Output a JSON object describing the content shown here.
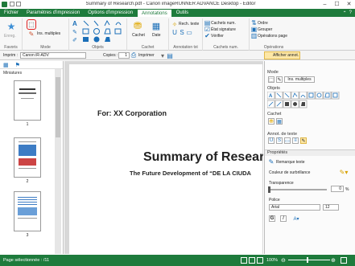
{
  "window": {
    "title": "Summary of Research.pdf - Canon imageRUNNER ADVANCE Desktop - Editor",
    "minimize": "–",
    "maximize": "☐",
    "close": "✕"
  },
  "tabs": [
    "Fichier",
    "Paramètres d'impression",
    "Options d'impression",
    "Annotations",
    "Outils"
  ],
  "active_tab": "Annotations",
  "ribbon": {
    "favoris": {
      "label": "Favoris",
      "button": "Enreg."
    },
    "mode": {
      "label": "Mode",
      "button": "Ins. multiples"
    },
    "objets": {
      "label": "Objets"
    },
    "cachet": {
      "label": "Cachet",
      "cachet_btn": "Cachet",
      "date_btn": "Date"
    },
    "annotation_txt": {
      "label": "Annotation txt",
      "btn": "Rech. texte"
    },
    "cachets_num": {
      "label": "Cachets num.",
      "items": [
        "Cachets num.",
        "État signature",
        "Vérifier"
      ]
    },
    "operations": {
      "label": "Opérations",
      "items": [
        "Ordre",
        "Grouper",
        "Opérations page"
      ]
    }
  },
  "toolbar2": {
    "imprim_label": "Imprim :",
    "printer": "Canon iR-ADV",
    "copies_label": "Copies :",
    "copies_value": "1",
    "imprimer": "Imprimer",
    "afficher": "Afficher annot."
  },
  "leftpane": {
    "title": "Miniatures",
    "pages": [
      "1",
      "2",
      "3"
    ]
  },
  "document": {
    "corp": "For: XX Corporation",
    "title": "Summary of Researc",
    "subtitle": "The Future Development of “DE LA CIUDA"
  },
  "rightpane": {
    "mode": {
      "title": "Mode",
      "btn": "Ins. multiples"
    },
    "objets_title": "Objets",
    "cachet_title": "Cachet",
    "annot_title": "Annot. de texte",
    "proprietes_title": "Propriétés",
    "remarque": "Remarque texte",
    "couleur_label": "Couleur de surbrillance",
    "transparence_label": "Transparence",
    "transparence_value": "0",
    "transparence_unit": "%",
    "police_label": "Police",
    "font": "Arial",
    "size": "12"
  },
  "statusbar": {
    "left": "Page sélectionnée : /11",
    "zoom": "100%"
  },
  "colors": {
    "brand": "#1e7b3c",
    "highlight": "#e02020"
  }
}
